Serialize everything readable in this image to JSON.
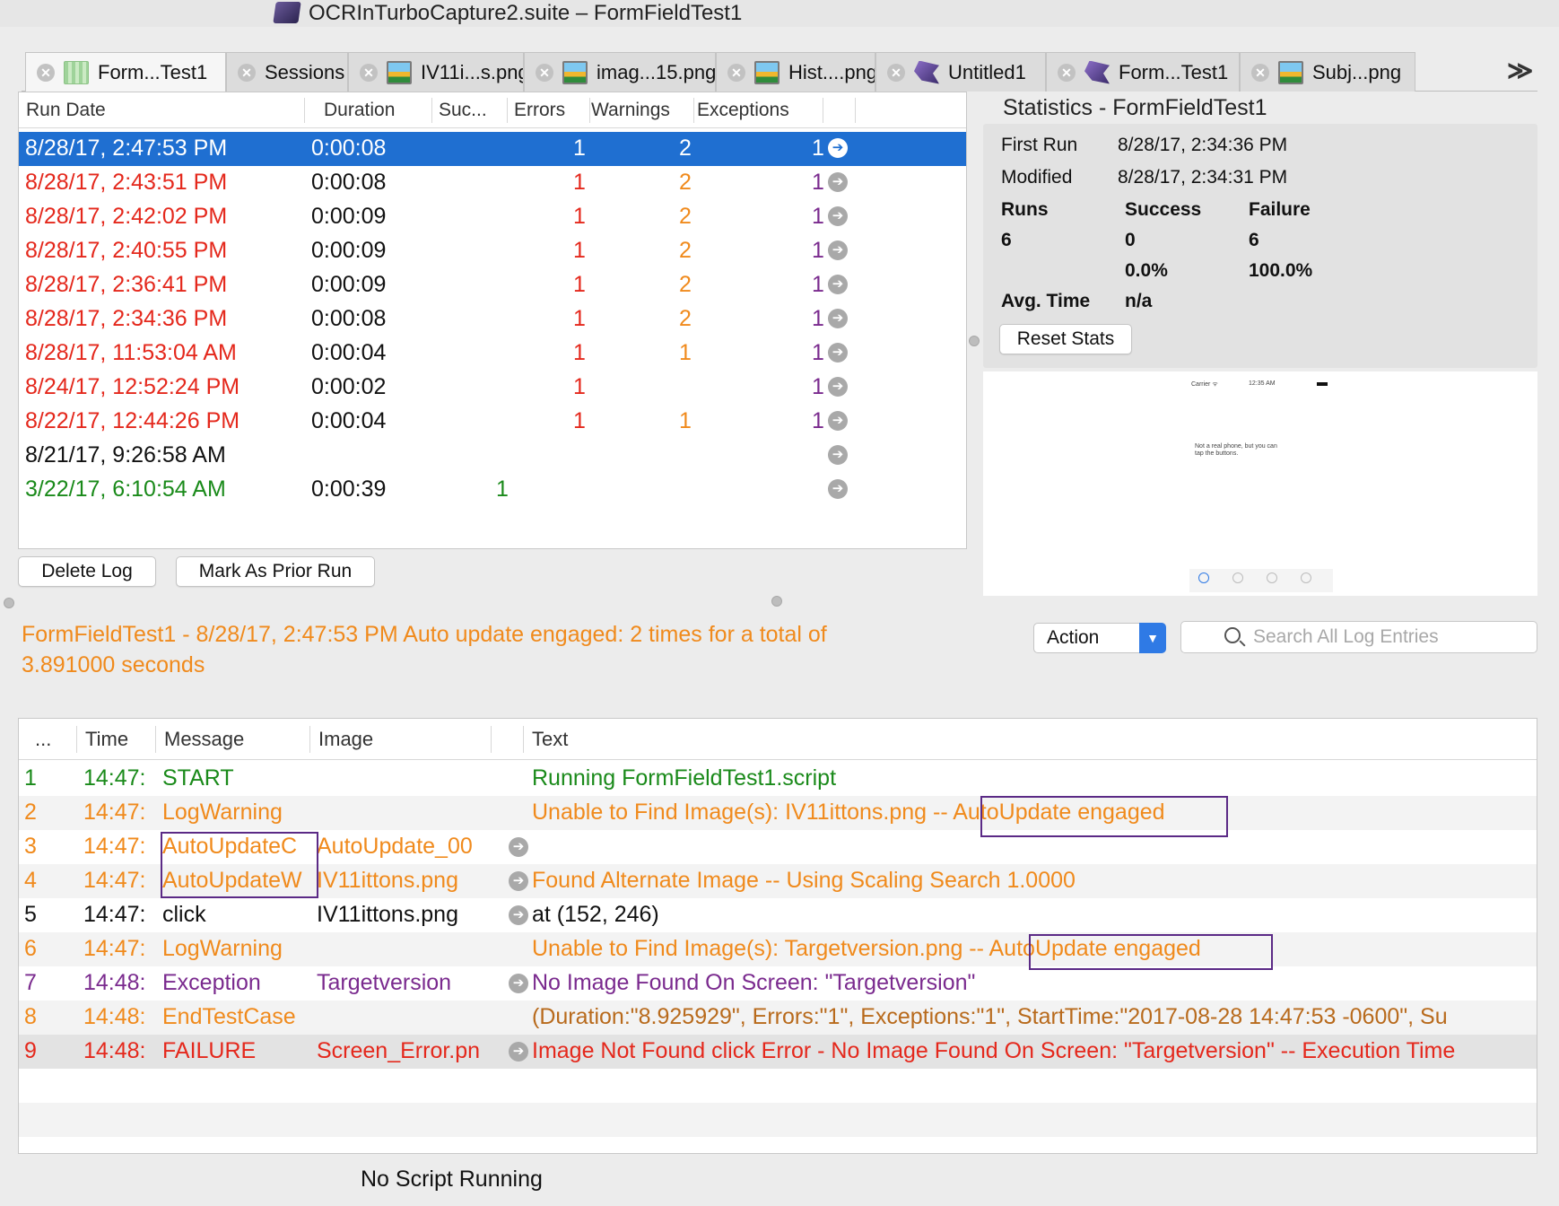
{
  "window": {
    "title": "OCRInTurboCapture2.suite – FormFieldTest1"
  },
  "tabs": [
    {
      "label": "Form...Test1",
      "icon": "grid-icon",
      "active": true
    },
    {
      "label": "Sessions",
      "icon": "",
      "active": false
    },
    {
      "label": "IV11i...s.png",
      "icon": "image-icon",
      "active": false
    },
    {
      "label": "imag...15.png",
      "icon": "image-icon",
      "active": false
    },
    {
      "label": "Hist....png",
      "icon": "image-icon",
      "active": false
    },
    {
      "label": "Untitled1",
      "icon": "suite-icon",
      "active": false
    },
    {
      "label": "Form...Test1",
      "icon": "suite-icon",
      "active": false
    },
    {
      "label": "Subj...png",
      "icon": "image-icon",
      "active": false
    }
  ],
  "tabs_overflow": "≫",
  "runs": {
    "columns": [
      "Run Date",
      "Duration",
      "Suc...",
      "Errors",
      "Warnings",
      "Exceptions"
    ],
    "rows": [
      {
        "date": "8/28/17, 2:47:53 PM",
        "duration": "0:00:08",
        "success": "",
        "errors": "1",
        "warnings": "2",
        "exceptions": "1",
        "status": "selected"
      },
      {
        "date": "8/28/17, 2:43:51 PM",
        "duration": "0:00:08",
        "success": "",
        "errors": "1",
        "warnings": "2",
        "exceptions": "1",
        "status": "failure"
      },
      {
        "date": "8/28/17, 2:42:02 PM",
        "duration": "0:00:09",
        "success": "",
        "errors": "1",
        "warnings": "2",
        "exceptions": "1",
        "status": "failure"
      },
      {
        "date": "8/28/17, 2:40:55 PM",
        "duration": "0:00:09",
        "success": "",
        "errors": "1",
        "warnings": "2",
        "exceptions": "1",
        "status": "failure"
      },
      {
        "date": "8/28/17, 2:36:41 PM",
        "duration": "0:00:09",
        "success": "",
        "errors": "1",
        "warnings": "2",
        "exceptions": "1",
        "status": "failure"
      },
      {
        "date": "8/28/17, 2:34:36 PM",
        "duration": "0:00:08",
        "success": "",
        "errors": "1",
        "warnings": "2",
        "exceptions": "1",
        "status": "failure"
      },
      {
        "date": "8/28/17, 11:53:04 AM",
        "duration": "0:00:04",
        "success": "",
        "errors": "1",
        "warnings": "1",
        "exceptions": "1",
        "status": "failure"
      },
      {
        "date": "8/24/17, 12:52:24 PM",
        "duration": "0:00:02",
        "success": "",
        "errors": "1",
        "warnings": "",
        "exceptions": "1",
        "status": "failure"
      },
      {
        "date": "8/22/17, 12:44:26 PM",
        "duration": "0:00:04",
        "success": "",
        "errors": "1",
        "warnings": "1",
        "exceptions": "1",
        "status": "failure"
      },
      {
        "date": "8/21/17, 9:26:58 AM",
        "duration": "",
        "success": "",
        "errors": "",
        "warnings": "",
        "exceptions": "",
        "status": "none"
      },
      {
        "date": "3/22/17, 6:10:54 AM",
        "duration": "0:00:39",
        "success": "1",
        "errors": "",
        "warnings": "",
        "exceptions": "",
        "status": "success"
      }
    ]
  },
  "buttons": {
    "delete_log": "Delete Log",
    "mark_prior": "Mark As Prior Run",
    "reset_stats": "Reset Stats"
  },
  "statistics": {
    "title": "Statistics - FormFieldTest1",
    "first_run_label": "First Run",
    "first_run": "8/28/17, 2:34:36 PM",
    "modified_label": "Modified",
    "modified": "8/28/17, 2:34:31 PM",
    "runs_label": "Runs",
    "success_label": "Success",
    "failure_label": "Failure",
    "runs": "6",
    "success": "0",
    "failure": "6",
    "success_pct": "0.0%",
    "failure_pct": "100.0%",
    "avg_label": "Avg. Time",
    "avg": "n/a"
  },
  "preview": {
    "carrier": "Carrier ᯤ",
    "clock": "12:35 AM",
    "message_line1": "Not a real phone, but you can",
    "message_line2": "tap the buttons."
  },
  "summary": {
    "text": "FormFieldTest1 - 8/28/17, 2:47:53 PM Auto update engaged: 2 times for a total of 3.891000 seconds"
  },
  "action": {
    "label": "Action"
  },
  "search": {
    "placeholder": "Search All Log Entries"
  },
  "log": {
    "columns": [
      "...",
      "Time",
      "Message",
      "Image",
      "Text"
    ],
    "rows": [
      {
        "num": "1",
        "time": "14:47:",
        "message": "START",
        "image": "",
        "text": "Running FormFieldTest1.script",
        "color": "g",
        "arrow": false
      },
      {
        "num": "2",
        "time": "14:47:",
        "message": "LogWarning",
        "image": "",
        "text": "Unable to Find Image(s): IV11ittons.png -- AutoUpdate engaged",
        "color": "o",
        "arrow": false
      },
      {
        "num": "3",
        "time": "14:47:",
        "message": "AutoUpdateC",
        "image": "AutoUpdate_00",
        "text": "",
        "color": "o",
        "arrow": true
      },
      {
        "num": "4",
        "time": "14:47:",
        "message": "AutoUpdateW",
        "image": "IV11ittons.png",
        "text": "Found Alternate Image -- Using Scaling Search 1.0000",
        "color": "o",
        "arrow": true
      },
      {
        "num": "5",
        "time": "14:47:",
        "message": "click",
        "image": "IV11ittons.png",
        "text": "at (152, 246)",
        "color": "k",
        "arrow": true
      },
      {
        "num": "6",
        "time": "14:47:",
        "message": "LogWarning",
        "image": "",
        "text": "Unable to Find Image(s): Targetversion.png -- AutoUpdate engaged",
        "color": "o",
        "arrow": false
      },
      {
        "num": "7",
        "time": "14:48:",
        "message": "Exception",
        "image": "Targetversion",
        "text": "No Image Found On Screen: \"Targetversion\"",
        "color": "p",
        "arrow": true
      },
      {
        "num": "8",
        "time": "14:48:",
        "message": "EndTestCase",
        "image": "",
        "text": "(Duration:\"8.925929\", Errors:\"1\", Exceptions:\"1\", StartTime:\"2017-08-28 14:47:53 -0600\", Su",
        "color": "mixed",
        "arrow": false
      },
      {
        "num": "9",
        "time": "14:48:",
        "message": "FAILURE",
        "image": "Screen_Error.pn",
        "text": "Image Not Found click Error - No Image Found On Screen: \"Targetversion\" -- Execution Time",
        "color": "r",
        "arrow": true
      }
    ]
  },
  "status": {
    "text": "No Script Running"
  },
  "colors": {
    "selection": "#1f6fd1",
    "warning": "#f08a1c",
    "error": "#e4281c",
    "success": "#1a8a1a",
    "exception": "#7a2a8e",
    "highlight": "#5b2a86"
  }
}
